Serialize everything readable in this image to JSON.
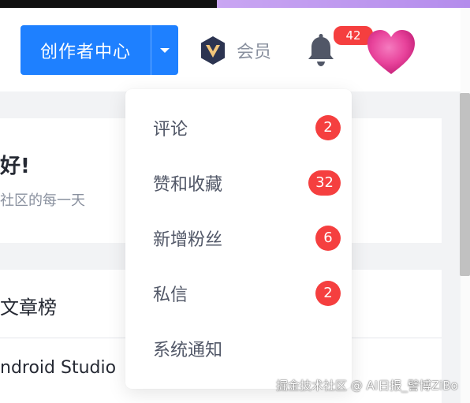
{
  "header": {
    "creator_button_label": "创作者中心",
    "member_label": "会员",
    "notification_count": "42"
  },
  "greeting": {
    "title": "好!",
    "subtitle": "社区的每一天"
  },
  "ranking": {
    "title": "文章榜",
    "first_item": "ndroid Studio"
  },
  "notification_menu": {
    "items": [
      {
        "label": "评论",
        "count": "2"
      },
      {
        "label": "赞和收藏",
        "count": "32"
      },
      {
        "label": "新增粉丝",
        "count": "6"
      },
      {
        "label": "私信",
        "count": "2"
      },
      {
        "label": "系统通知",
        "count": ""
      }
    ]
  },
  "watermark": "掘金技术社区 @ AI日报_譬博ZiBo",
  "colors": {
    "primary": "#1e80ff",
    "badge": "#f53f3f",
    "page_bg": "#f2f3f5",
    "text_primary": "#252933",
    "text_secondary": "#8a919f"
  },
  "icons": [
    "chevron-down-icon",
    "vip-badge-icon",
    "bell-icon",
    "heart-avatar"
  ]
}
